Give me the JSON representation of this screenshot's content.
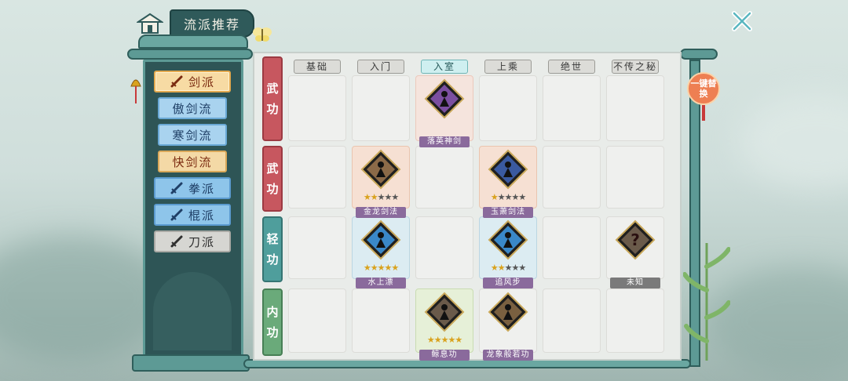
{
  "header": {
    "title": "流派推荐"
  },
  "menu": {
    "sects": [
      {
        "label": "剑派",
        "style": "gold",
        "major": true,
        "selected": true
      },
      {
        "label": "傲剑流",
        "style": "blue",
        "major": false
      },
      {
        "label": "寒剑流",
        "style": "blue",
        "major": false
      },
      {
        "label": "快剑流",
        "style": "gold",
        "major": false
      },
      {
        "label": "拳派",
        "style": "blue-deep",
        "major": true
      },
      {
        "label": "棍派",
        "style": "blue-deep",
        "major": true
      },
      {
        "label": "刀派",
        "style": "gray",
        "major": true
      }
    ]
  },
  "columns": [
    "基础",
    "入门",
    "入室",
    "上乘",
    "绝世",
    "不传之秘"
  ],
  "active_column": 2,
  "rows": [
    {
      "label": [
        "武",
        "功"
      ],
      "color": "red"
    },
    {
      "label": [
        "武",
        "功"
      ],
      "color": "red"
    },
    {
      "label": [
        "轻",
        "功"
      ],
      "color": "teal"
    },
    {
      "label": [
        "内",
        "功"
      ],
      "color": "green"
    }
  ],
  "skills": [
    {
      "row": 0,
      "col": 2,
      "name": "落英神剑",
      "stars": 0,
      "color": "#7b4fa0",
      "cell": "pink"
    },
    {
      "row": 1,
      "col": 1,
      "name": "金龙剑法",
      "stars": 2,
      "color": "#8b6a48",
      "cell": "peach"
    },
    {
      "row": 1,
      "col": 3,
      "name": "玉萧剑法",
      "stars": 1,
      "color": "#3a5aa0",
      "cell": "peach"
    },
    {
      "row": 2,
      "col": 1,
      "name": "水上漂",
      "stars": 5,
      "color": "#3a88c8",
      "cell": "blue"
    },
    {
      "row": 2,
      "col": 3,
      "name": "追风步",
      "stars": 2,
      "color": "#3a88c8",
      "cell": "blue"
    },
    {
      "row": 2,
      "col": 5,
      "name": "未知",
      "stars": 0,
      "color": "#6a5a4a",
      "cell": "none",
      "unknown": true
    },
    {
      "row": 3,
      "col": 2,
      "name": "鲸息功",
      "stars": 5,
      "color": "#6a5a4a",
      "cell": "green"
    },
    {
      "row": 3,
      "col": 3,
      "name": "龙象般若功",
      "stars": 0,
      "color": "#7a6040",
      "cell": "none"
    }
  ],
  "swap_button": {
    "label": "一键替换"
  },
  "colors": {
    "frame": "#5d9a95",
    "panel": "#2e5556",
    "accent_orange": "#ee7f52"
  }
}
